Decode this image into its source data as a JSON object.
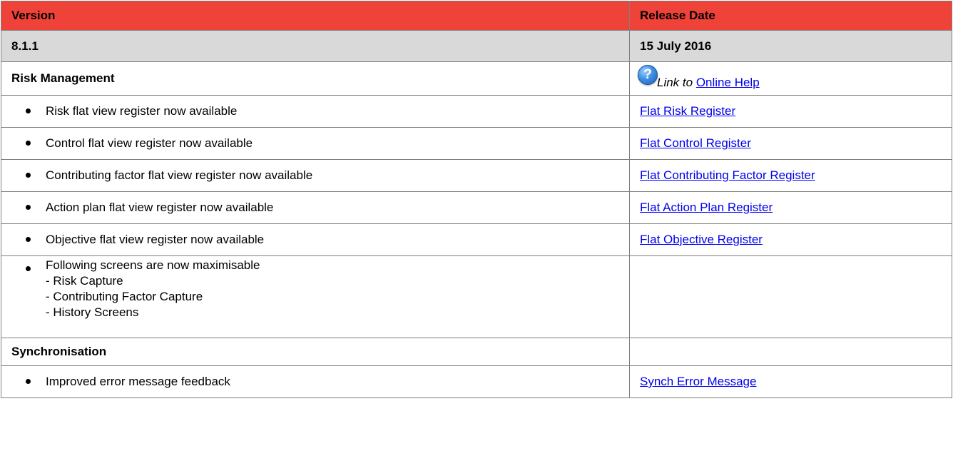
{
  "header": {
    "version_label": "Version",
    "date_label": "Release Date"
  },
  "release": {
    "version": "8.1.1",
    "date": "15 July 2016"
  },
  "risk_section": {
    "title": "Risk Management",
    "help_prefix": "Link to",
    "help_link": "Online Help"
  },
  "risk_items": [
    {
      "text": "Risk flat view register now available",
      "link": "Flat Risk Register"
    },
    {
      "text": "Control flat view register now available",
      "link": "Flat Control Register"
    },
    {
      "text": "Contributing factor flat view register now available",
      "link": "Flat Contributing Factor Register"
    },
    {
      "text": "Action plan flat view register now available",
      "link": "Flat Action Plan Register"
    },
    {
      "text": "Objective flat view register now available",
      "link": "Flat Objective Register"
    }
  ],
  "maximisable": {
    "text": "Following screens are now maximisable",
    "screens": [
      "- Risk Capture",
      "- Contributing Factor Capture",
      "- History Screens"
    ]
  },
  "sync_section": {
    "title": "Synchronisation"
  },
  "sync_items": [
    {
      "text": "Improved error message feedback",
      "link": "Synch Error Message"
    }
  ]
}
